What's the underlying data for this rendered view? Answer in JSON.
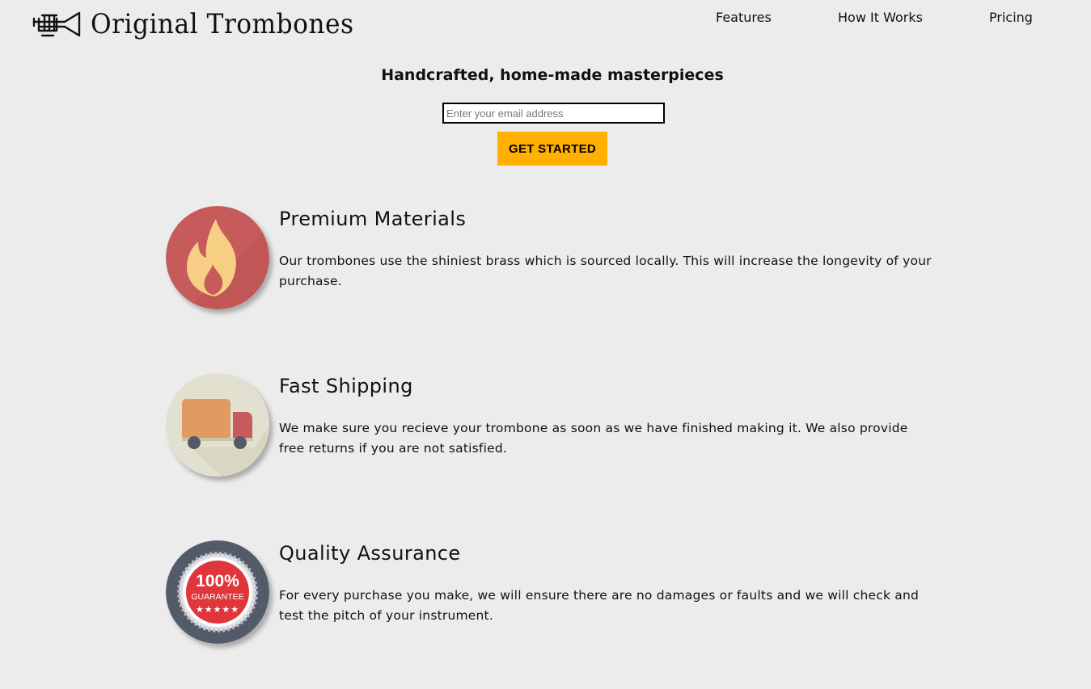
{
  "brand": {
    "name": "Original Trombones",
    "logo_icon": "trumpet-icon"
  },
  "nav": {
    "items": [
      {
        "label": "Features"
      },
      {
        "label": "How It Works"
      },
      {
        "label": "Pricing"
      }
    ]
  },
  "hero": {
    "title": "Handcrafted, home-made masterpieces",
    "email_placeholder": "Enter your email address",
    "email_value": "",
    "cta_label": "GET STARTED"
  },
  "features": [
    {
      "icon": "flame-icon",
      "title": "Premium Materials",
      "description": "Our trombones use the shiniest brass which is sourced locally. This will increase the longevity of your purchase."
    },
    {
      "icon": "delivery-truck-icon",
      "title": "Fast Shipping",
      "description": "We make sure you recieve your trombone as soon as we have finished making it. We also provide free returns if you are not satisfied."
    },
    {
      "icon": "guarantee-badge-icon",
      "title": "Quality Assurance",
      "description": "For every purchase you make, we will ensure there are no damages or faults and we will check and test the pitch of your instrument.",
      "badge_text": {
        "percent": "100%",
        "label": "GUARANTEE"
      }
    }
  ],
  "colors": {
    "background": "#ececec",
    "cta": "#ffb000",
    "flame_circle": "#c75b5b",
    "flame": "#f6cf85",
    "truck_circle": "#e2e0ce",
    "badge_circle": "#535a68",
    "badge_red": "#e0353b"
  }
}
